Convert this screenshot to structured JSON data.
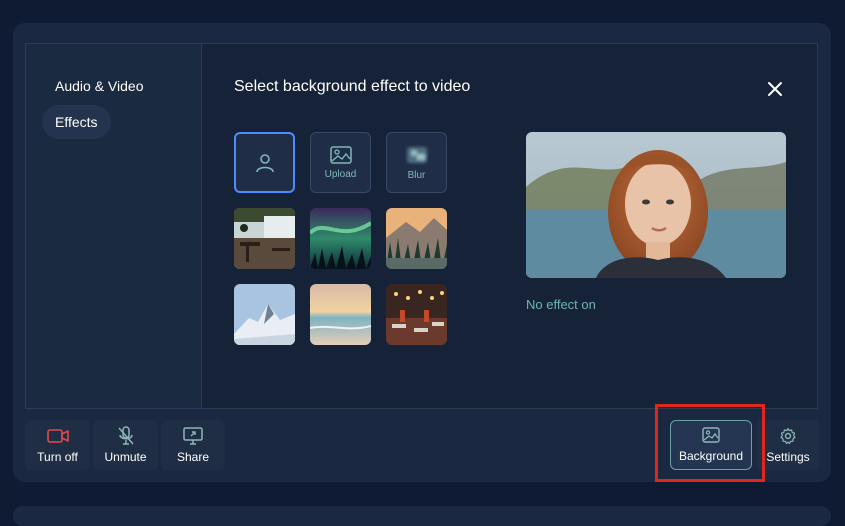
{
  "sidebar": {
    "items": [
      {
        "label": "Audio & Video",
        "active": false
      },
      {
        "label": "Effects",
        "active": true
      }
    ]
  },
  "dialog": {
    "title": "Select background effect to video",
    "status": "No effect on"
  },
  "effects": {
    "options": [
      {
        "label": "",
        "icon": "person-icon",
        "selected": true
      },
      {
        "label": "Upload",
        "icon": "image-icon"
      },
      {
        "label": "Blur",
        "icon": "blur-icon"
      }
    ],
    "backgrounds": [
      "cafe-interior",
      "aurora-forest",
      "mountain-forest-sunset",
      "snowy-mountain",
      "beach-sunset",
      "restaurant-lights"
    ]
  },
  "toolbar": {
    "turn_off": "Turn off",
    "unmute": "Unmute",
    "share": "Share",
    "background": "Background",
    "settings": "Settings"
  },
  "colors": {
    "accent_red": "#e04a4a",
    "teal_text": "#6fb3b3",
    "selection_blue": "#4b8dff",
    "annotation_red": "#e0271c"
  }
}
